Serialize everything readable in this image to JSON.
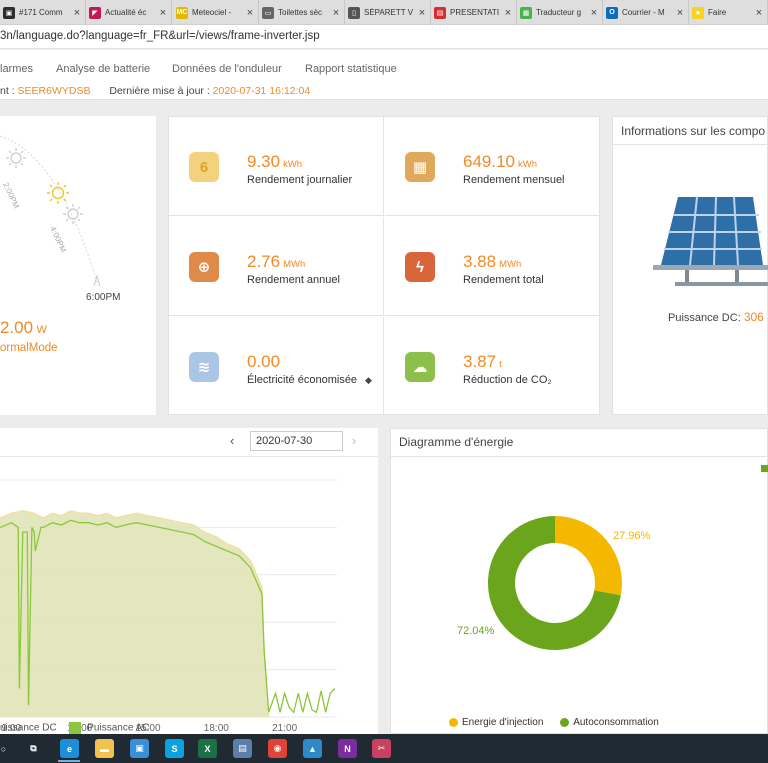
{
  "browser": {
    "tabs": [
      {
        "label": "#171 Comm",
        "color": "#2d2d2d",
        "glyph": "▣"
      },
      {
        "label": "Actualité éc",
        "color": "#c2185b",
        "glyph": "◤"
      },
      {
        "label": "Meteociel -",
        "color": "#e5b800",
        "glyph": "MC"
      },
      {
        "label": "Toilettes sèc",
        "color": "#666666",
        "glyph": "▭"
      },
      {
        "label": "SÉPARETT V",
        "color": "#555555",
        "glyph": "▯"
      },
      {
        "label": "PRESENTATI",
        "color": "#d32f2f",
        "glyph": "▤"
      },
      {
        "label": "Traducteur g",
        "color": "#4caf50",
        "glyph": "▦"
      },
      {
        "label": "Courrier - M",
        "color": "#0f6cbd",
        "glyph": "O"
      },
      {
        "label": "Faire",
        "color": "#f7d21e",
        "glyph": "★"
      }
    ],
    "url": "3n/language.do?language=fr_FR&url=/views/frame-inverter.jsp"
  },
  "nav": {
    "items": [
      "larmes",
      "Analyse de batterie",
      "Données de l'onduleur",
      "Rapport statistique"
    ]
  },
  "info": {
    "device_prefix": "nt : ",
    "device_id": "SEER6WYDSB",
    "update_label": "Dernière mise à jour : ",
    "update_value": "2020-07-31 16:12:04"
  },
  "sun_panel": {
    "time_labels": [
      "2:00PM",
      "4:00PM",
      "6:00PM"
    ],
    "power_value": "2.00",
    "power_unit": "W",
    "mode": "ormalMode"
  },
  "stats": [
    {
      "value": "9.30",
      "unit": "kWh",
      "label": "Rendement journalier",
      "icon": "calendar-day-icon",
      "bg": "#f3d27d",
      "fg": "#d9a525"
    },
    {
      "value": "649.10",
      "unit": "kWh",
      "label": "Rendement mensuel",
      "icon": "calendar-month-icon",
      "bg": "#e0a85a",
      "fg": "#ffffff"
    },
    {
      "value": "2.76",
      "unit": "MWh",
      "label": "Rendement annuel",
      "icon": "globe-icon",
      "bg": "#e08a4a",
      "fg": "#ffffff"
    },
    {
      "value": "3.88",
      "unit": "MWh",
      "label": "Rendement total",
      "icon": "lightning-icon",
      "bg": "#d9663a",
      "fg": "#ffffff"
    },
    {
      "value": "0.00",
      "unit": "",
      "label": "Électricité économisée",
      "icon": "coins-icon",
      "bg": "#a9c7e5",
      "fg": "#ffffff"
    },
    {
      "value": "3.87",
      "unit": "t",
      "label": "Réduction de CO₂",
      "icon": "co2-cloud-icon",
      "bg": "#8cc04a",
      "fg": "#ffffff"
    }
  ],
  "components": {
    "title": "Informations sur les compo",
    "dc_label": "Puissance DC: ",
    "dc_value": "306"
  },
  "power_chart": {
    "date": "2020-07-30",
    "prev": "‹",
    "next": "›",
    "legend": [
      {
        "label": "uissance DC",
        "color": "#f2dfa0"
      },
      {
        "label": "Puissance AC",
        "color": "#8cc63f"
      }
    ]
  },
  "chart_data": [
    {
      "type": "area",
      "title": "",
      "xlabel": "",
      "ylabel": "",
      "x_ticks": [
        "9:00",
        "12:00",
        "15:00",
        "18:00",
        "21:00"
      ],
      "x_range": [
        8.5,
        23.3
      ],
      "y_range": [
        0,
        1
      ],
      "grid": true,
      "series": [
        {
          "name": "Puissance DC",
          "x": [
            8.5,
            9.0,
            9.5,
            10.0,
            10.4,
            10.8,
            11.2,
            11.6,
            12.0,
            12.4,
            12.8,
            13.2,
            13.6,
            14.0,
            14.5,
            15.0,
            15.5,
            16.0,
            16.5,
            17.0,
            17.5,
            18.0,
            18.5,
            19.0,
            19.5,
            20.0,
            20.1,
            20.3
          ],
          "y": [
            0.84,
            0.86,
            0.87,
            0.86,
            0.84,
            0.86,
            0.85,
            0.87,
            0.86,
            0.86,
            0.85,
            0.86,
            0.84,
            0.85,
            0.86,
            0.85,
            0.84,
            0.83,
            0.82,
            0.81,
            0.78,
            0.76,
            0.73,
            0.71,
            0.66,
            0.55,
            0.3,
            0.0
          ]
        },
        {
          "name": "Puissance AC",
          "x": [
            8.5,
            9.0,
            9.3,
            9.35,
            9.5,
            9.7,
            9.75,
            9.9,
            10.0,
            10.05,
            10.3,
            10.4,
            10.8,
            11.2,
            11.6,
            12.0,
            12.4,
            12.8,
            13.2,
            13.6,
            14.0,
            14.5,
            15.0,
            15.5,
            16.0,
            16.5,
            17.0,
            17.5,
            18.0,
            18.5,
            19.0,
            19.5,
            20.0,
            20.1,
            20.3,
            20.6,
            20.8,
            21.0,
            21.2,
            21.4,
            21.6,
            21.8,
            22.0,
            22.2,
            22.4,
            22.6,
            22.8,
            23.0,
            23.2
          ],
          "y": [
            0.8,
            0.82,
            0.8,
            0.12,
            0.78,
            0.78,
            0.05,
            0.8,
            0.78,
            0.7,
            0.8,
            0.8,
            0.82,
            0.81,
            0.83,
            0.82,
            0.82,
            0.81,
            0.82,
            0.8,
            0.81,
            0.82,
            0.81,
            0.8,
            0.79,
            0.78,
            0.77,
            0.74,
            0.72,
            0.7,
            0.68,
            0.63,
            0.52,
            0.28,
            0.02,
            0.1,
            0.02,
            0.1,
            0.04,
            0.02,
            0.1,
            0.02,
            0.1,
            0.03,
            0.02,
            0.11,
            0.02,
            0.1,
            0.12
          ]
        }
      ]
    },
    {
      "type": "pie",
      "title": "Diagramme d'énergie",
      "series": [
        {
          "name": "Energie d'injection",
          "value": 27.96,
          "label": "27.96%",
          "color": "#f5b800"
        },
        {
          "name": "Autoconsommation",
          "value": 72.04,
          "label": "72.04%",
          "color": "#6aa51c"
        }
      ],
      "legend": "bottom"
    }
  ],
  "taskbar": {
    "icons": [
      {
        "name": "windows-start-icon",
        "glyph": "○",
        "bg": "transparent"
      },
      {
        "name": "task-view-icon",
        "glyph": "⧉",
        "bg": "transparent"
      },
      {
        "name": "edge-icon",
        "glyph": "e",
        "bg": "#1c8fd6"
      },
      {
        "name": "file-explorer-icon",
        "glyph": "▬",
        "bg": "#f2c14e"
      },
      {
        "name": "photos-icon",
        "glyph": "▣",
        "bg": "#3a8fd8"
      },
      {
        "name": "skype-icon",
        "glyph": "S",
        "bg": "#0aa2e0"
      },
      {
        "name": "excel-icon",
        "glyph": "X",
        "bg": "#1d7044"
      },
      {
        "name": "window-app-icon",
        "glyph": "▤",
        "bg": "#5a7fa8"
      },
      {
        "name": "chrome-icon",
        "glyph": "◉",
        "bg": "#db4437"
      },
      {
        "name": "image-viewer-icon",
        "glyph": "▲",
        "bg": "#2d89c8"
      },
      {
        "name": "onenote-icon",
        "glyph": "N",
        "bg": "#7b2c9e"
      },
      {
        "name": "snipping-tool-icon",
        "glyph": "✂",
        "bg": "#c94060"
      }
    ]
  }
}
